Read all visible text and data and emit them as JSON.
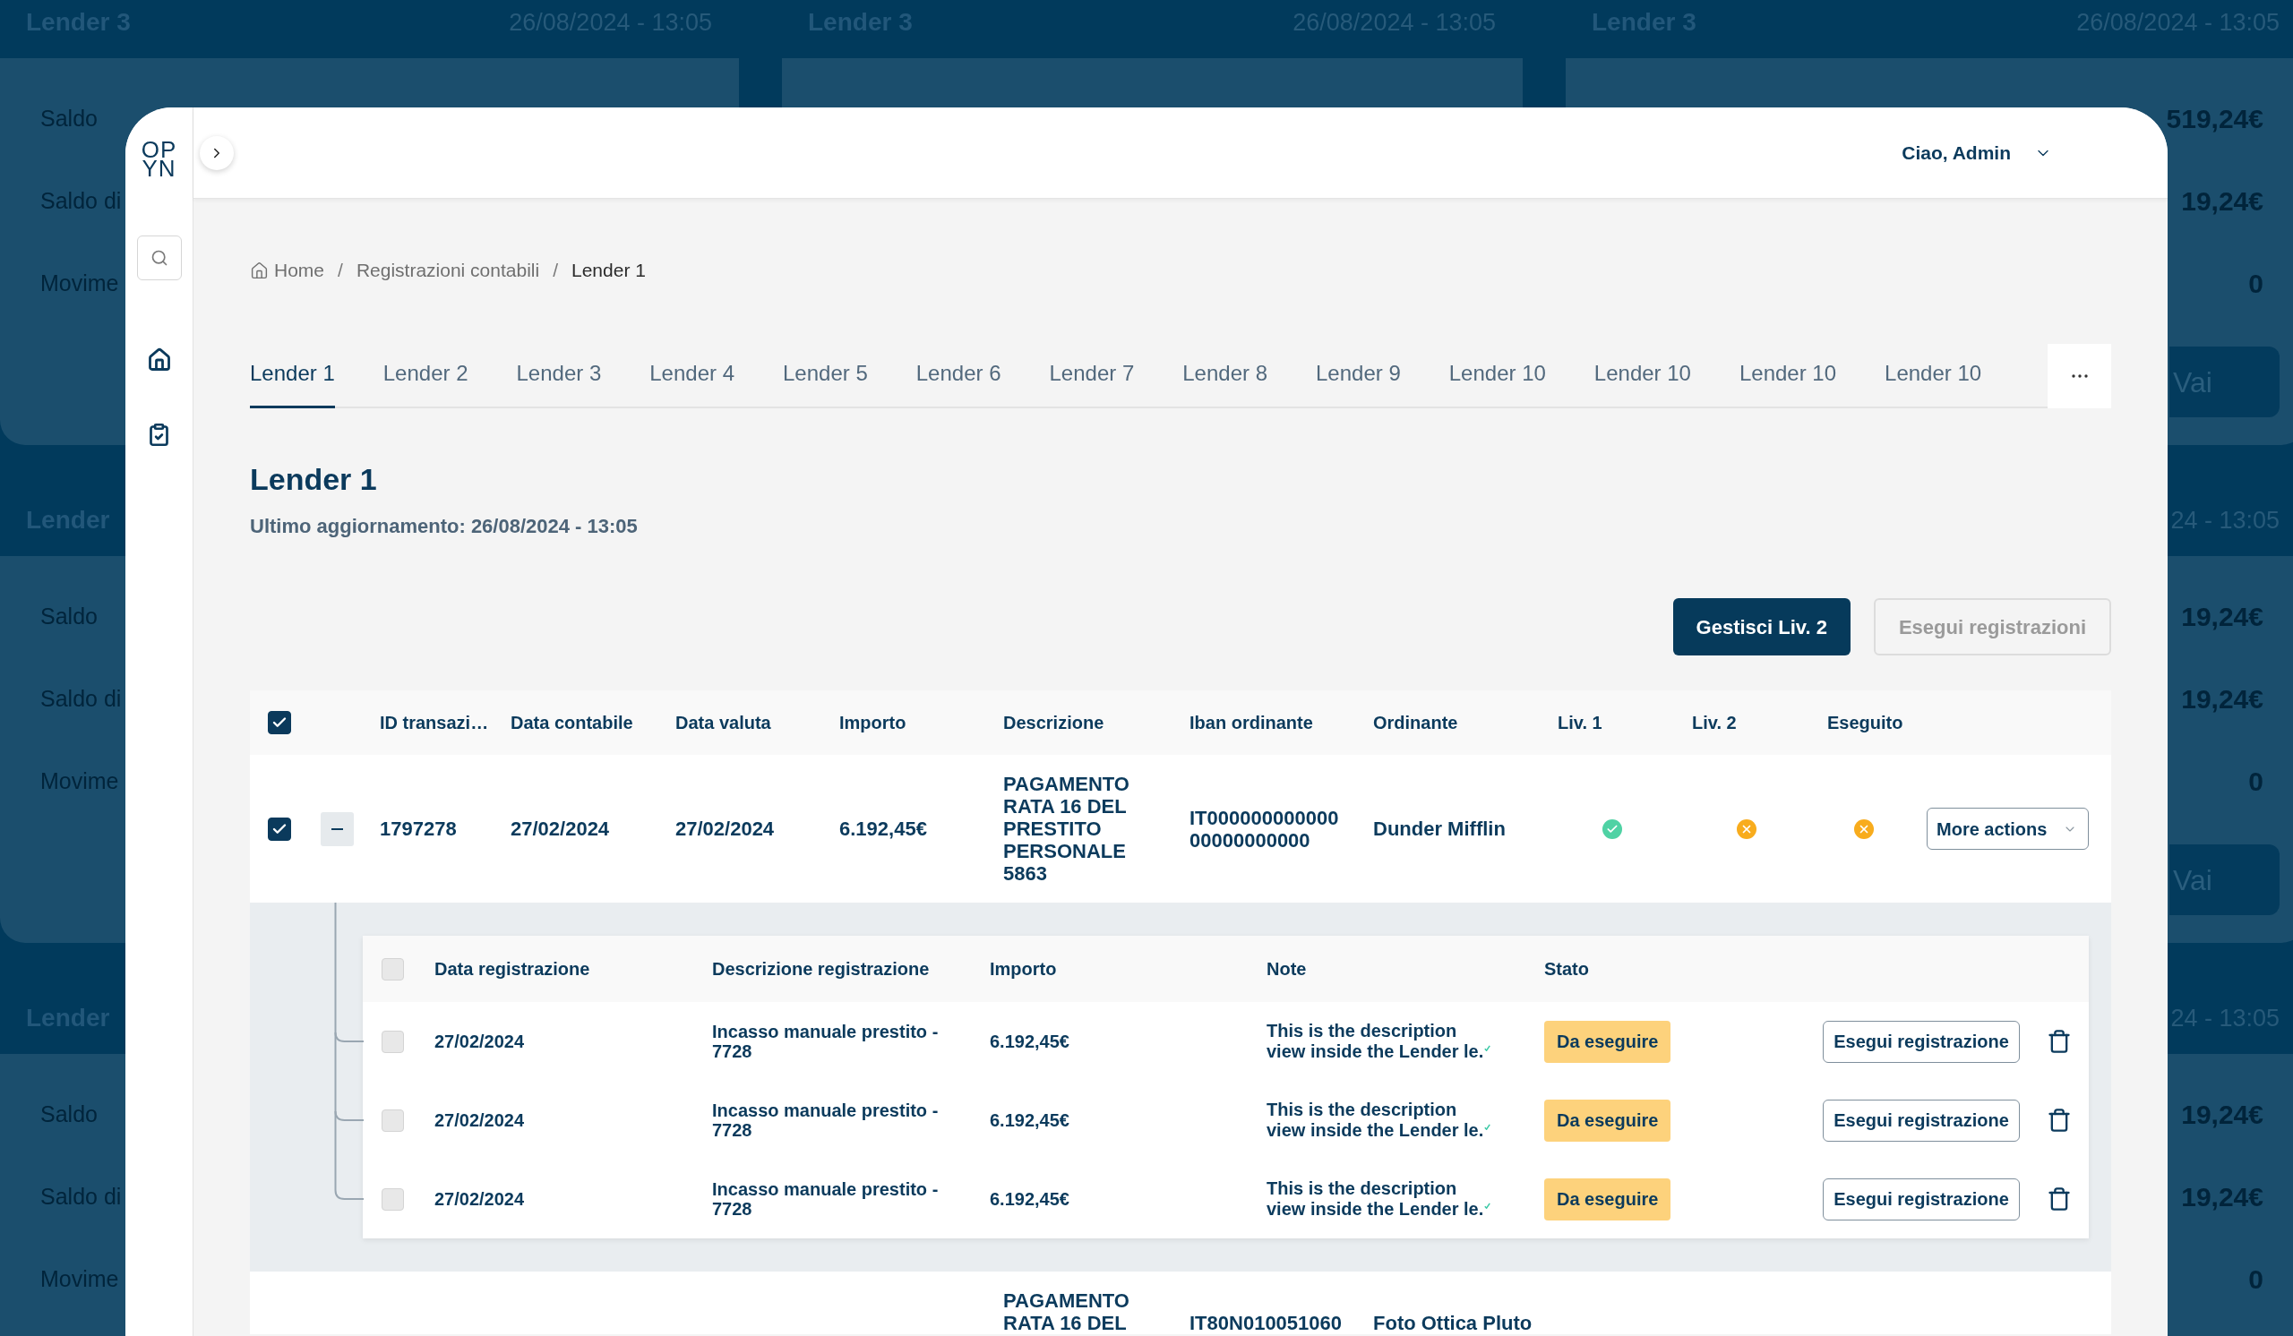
{
  "background": {
    "rows": [
      {
        "left": {
          "title": "Lender 3",
          "date": "26/08/2024 - 13:05",
          "labels": [
            "Saldo",
            "Saldo di",
            "Movime"
          ]
        },
        "middle": {
          "title": "Lender 3",
          "date": "26/08/2024 - 13:05"
        },
        "right": {
          "title": "Lender 3",
          "date": "26/08/2024 - 13:05",
          "values": [
            "519,24€",
            "19,24€",
            "0"
          ],
          "button": "Vai"
        }
      },
      {
        "left": {
          "title": "Lender",
          "labels": [
            "Saldo",
            "Saldo di",
            "Movime"
          ]
        },
        "right": {
          "date": "24 - 13:05",
          "values": [
            "19,24€",
            "19,24€",
            "0"
          ],
          "button": "Vai"
        }
      },
      {
        "left": {
          "title": "Lender",
          "labels": [
            "Saldo",
            "Saldo di",
            "Movime"
          ]
        },
        "right": {
          "date": "24 - 13:05",
          "values": [
            "19,24€",
            "19,24€",
            "0"
          ]
        }
      }
    ]
  },
  "sidebar": {
    "logo": [
      "OP",
      "YN"
    ]
  },
  "header": {
    "user": "Ciao, Admin"
  },
  "breadcrumb": [
    {
      "kind": "home",
      "label": "Home"
    },
    {
      "kind": "separator",
      "label": "/"
    },
    {
      "kind": "link",
      "label": "Registrazioni contabili"
    },
    {
      "kind": "separator",
      "label": "/"
    },
    {
      "kind": "current",
      "label": "Lender 1"
    }
  ],
  "tabs": [
    {
      "label": "Lender 1",
      "selected": true
    },
    {
      "label": "Lender 2",
      "selected": false
    },
    {
      "label": "Lender 3",
      "selected": false
    },
    {
      "label": "Lender 4",
      "selected": false
    },
    {
      "label": "Lender 5",
      "selected": false
    },
    {
      "label": "Lender 6",
      "selected": false
    },
    {
      "label": "Lender 7",
      "selected": false
    },
    {
      "label": "Lender 8",
      "selected": false
    },
    {
      "label": "Lender 9",
      "selected": false
    },
    {
      "label": "Lender 10",
      "selected": false
    },
    {
      "label": "Lender 10",
      "selected": false
    },
    {
      "label": "Lender 10",
      "selected": false
    },
    {
      "label": "Lender 10",
      "selected": false
    }
  ],
  "page": {
    "title": "Lender 1",
    "subtitle": "Ultimo aggiornamento: 26/08/2024 - 13:05"
  },
  "actions": [
    {
      "label": "Gestisci Liv. 2",
      "disabled": false
    },
    {
      "label": "Esegui registrazioni",
      "disabled": true
    }
  ],
  "table": {
    "select_all": {
      "checked": true
    },
    "columns": [
      "ID transazi…",
      "Data contabile",
      "Data valuta",
      "Importo",
      "Descrizione",
      "Iban ordinante",
      "Ordinante",
      "Liv. 1",
      "Liv. 2",
      "Eseguito"
    ],
    "rows": [
      {
        "selected": true,
        "expanded": true,
        "id": "1797278",
        "data_contabile": "27/02/2024",
        "data_valuta": "27/02/2024",
        "importo": "6.192,45€",
        "descrizione": "PAGAMENTO RATA 16 DEL PRESTITO PERSONALE 5863",
        "iban": "IT00000000000000000000000",
        "ordinante": "Dunder Mifflin",
        "checks": [
          {
            "done": true
          },
          {
            "done": false
          },
          {
            "done": false
          }
        ],
        "menu": "More actions",
        "sub_table": {
          "select_all": {
            "selected": false,
            "disabled": true
          },
          "columns": [
            "Data registrazione",
            "Descrizione registrazione",
            "Importo",
            "Note",
            "Stato"
          ],
          "rows": [
            {
              "selected": false,
              "disabled": true,
              "date": "27/02/2024",
              "description": "Incasso manuale prestito - 7728",
              "amount": "6.192,45€",
              "note": "This is the description view inside the Lender le.",
              "status": "Da eseguire",
              "action": "Esegui registrazione"
            },
            {
              "selected": false,
              "disabled": true,
              "date": "27/02/2024",
              "description": "Incasso manuale prestito - 7728",
              "amount": "6.192,45€",
              "note": "This is the description view inside the Lender le.",
              "status": "Da eseguire",
              "action": "Esegui registrazione"
            },
            {
              "selected": false,
              "disabled": true,
              "date": "27/02/2024",
              "description": "Incasso manuale prestito - 7728",
              "amount": "6.192,45€",
              "note": "This is the description view inside the Lender le.",
              "status": "Da eseguire",
              "action": "Esegui registrazione"
            }
          ]
        }
      },
      {
        "descrizione": "PAGAMENTO RATA 16 DEL",
        "iban": "IT80N010051060",
        "ordinante": "Foto Ottica Pluto"
      }
    ]
  }
}
